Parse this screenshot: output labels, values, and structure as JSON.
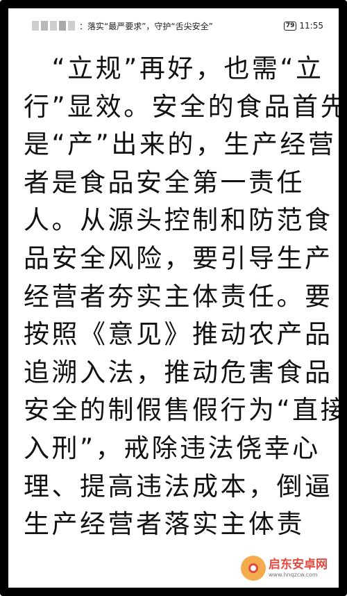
{
  "status_bar": {
    "doc_title": "：落实“最严要求”，守护“舌尖安全”",
    "battery": "79",
    "time": "11:55"
  },
  "article": {
    "lines": [
      "　“立规”再好，也需“立",
      "行”显效。安全的食品首先",
      "是“产”出来的，生产经营",
      "者是食品安全第一责任",
      "人。从源头控制和防范食",
      "品安全风险，要引导生产",
      "经营者夯实主体责任。要",
      "按照《意见》推动农产品",
      "追溯入法，推动危害食品",
      "安全的制假售假行为“直接",
      "入刑”，戒除违法侥幸心",
      "理、提高违法成本，倒逼",
      "生产经营者落实主体责"
    ]
  },
  "watermark": {
    "cn": "启东安卓网",
    "en": "www.hnqzcw.com"
  }
}
